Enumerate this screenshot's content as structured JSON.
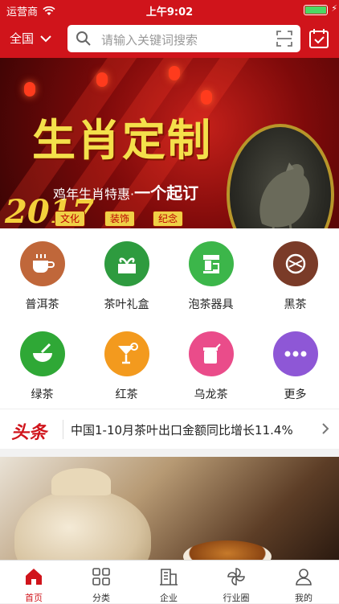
{
  "status_bar": {
    "carrier": "运营商",
    "time": "上午9:02"
  },
  "header": {
    "region": "全国",
    "search_placeholder": "请输入关键词搜索"
  },
  "banner": {
    "title": "生肖定制",
    "year": "2017",
    "subtitle_prefix": "鸡年生肖特惠",
    "subtitle_main": "一个起订",
    "tags": [
      "文化",
      "装饰",
      "纪念"
    ]
  },
  "categories": [
    {
      "label": "普洱茶",
      "icon": "tea-cup-icon",
      "color": "#c0673a"
    },
    {
      "label": "茶叶礼盒",
      "icon": "gift-box-icon",
      "color": "#2e9b3f"
    },
    {
      "label": "泡茶器具",
      "icon": "tea-machine-icon",
      "color": "#3cb64a"
    },
    {
      "label": "黑茶",
      "icon": "tea-cake-icon",
      "color": "#7a3b28"
    },
    {
      "label": "绿茶",
      "icon": "mortar-icon",
      "color": "#2fa836"
    },
    {
      "label": "红茶",
      "icon": "cocktail-icon",
      "color": "#f39a1e"
    },
    {
      "label": "乌龙茶",
      "icon": "jar-icon",
      "color": "#ea4c8a"
    },
    {
      "label": "更多",
      "icon": "more-icon",
      "color": "#8e57d6"
    }
  ],
  "headline": {
    "logo": "头条",
    "text": "中国1-10月茶叶出口金额同比增长11.4%"
  },
  "tabs": [
    {
      "label": "首页",
      "icon": "home-icon",
      "active": true
    },
    {
      "label": "分类",
      "icon": "grid-icon",
      "active": false
    },
    {
      "label": "企业",
      "icon": "building-icon",
      "active": false
    },
    {
      "label": "行业圈",
      "icon": "pinwheel-icon",
      "active": false
    },
    {
      "label": "我的",
      "icon": "person-icon",
      "active": false
    }
  ],
  "colors": {
    "brand_red": "#d0141b"
  }
}
